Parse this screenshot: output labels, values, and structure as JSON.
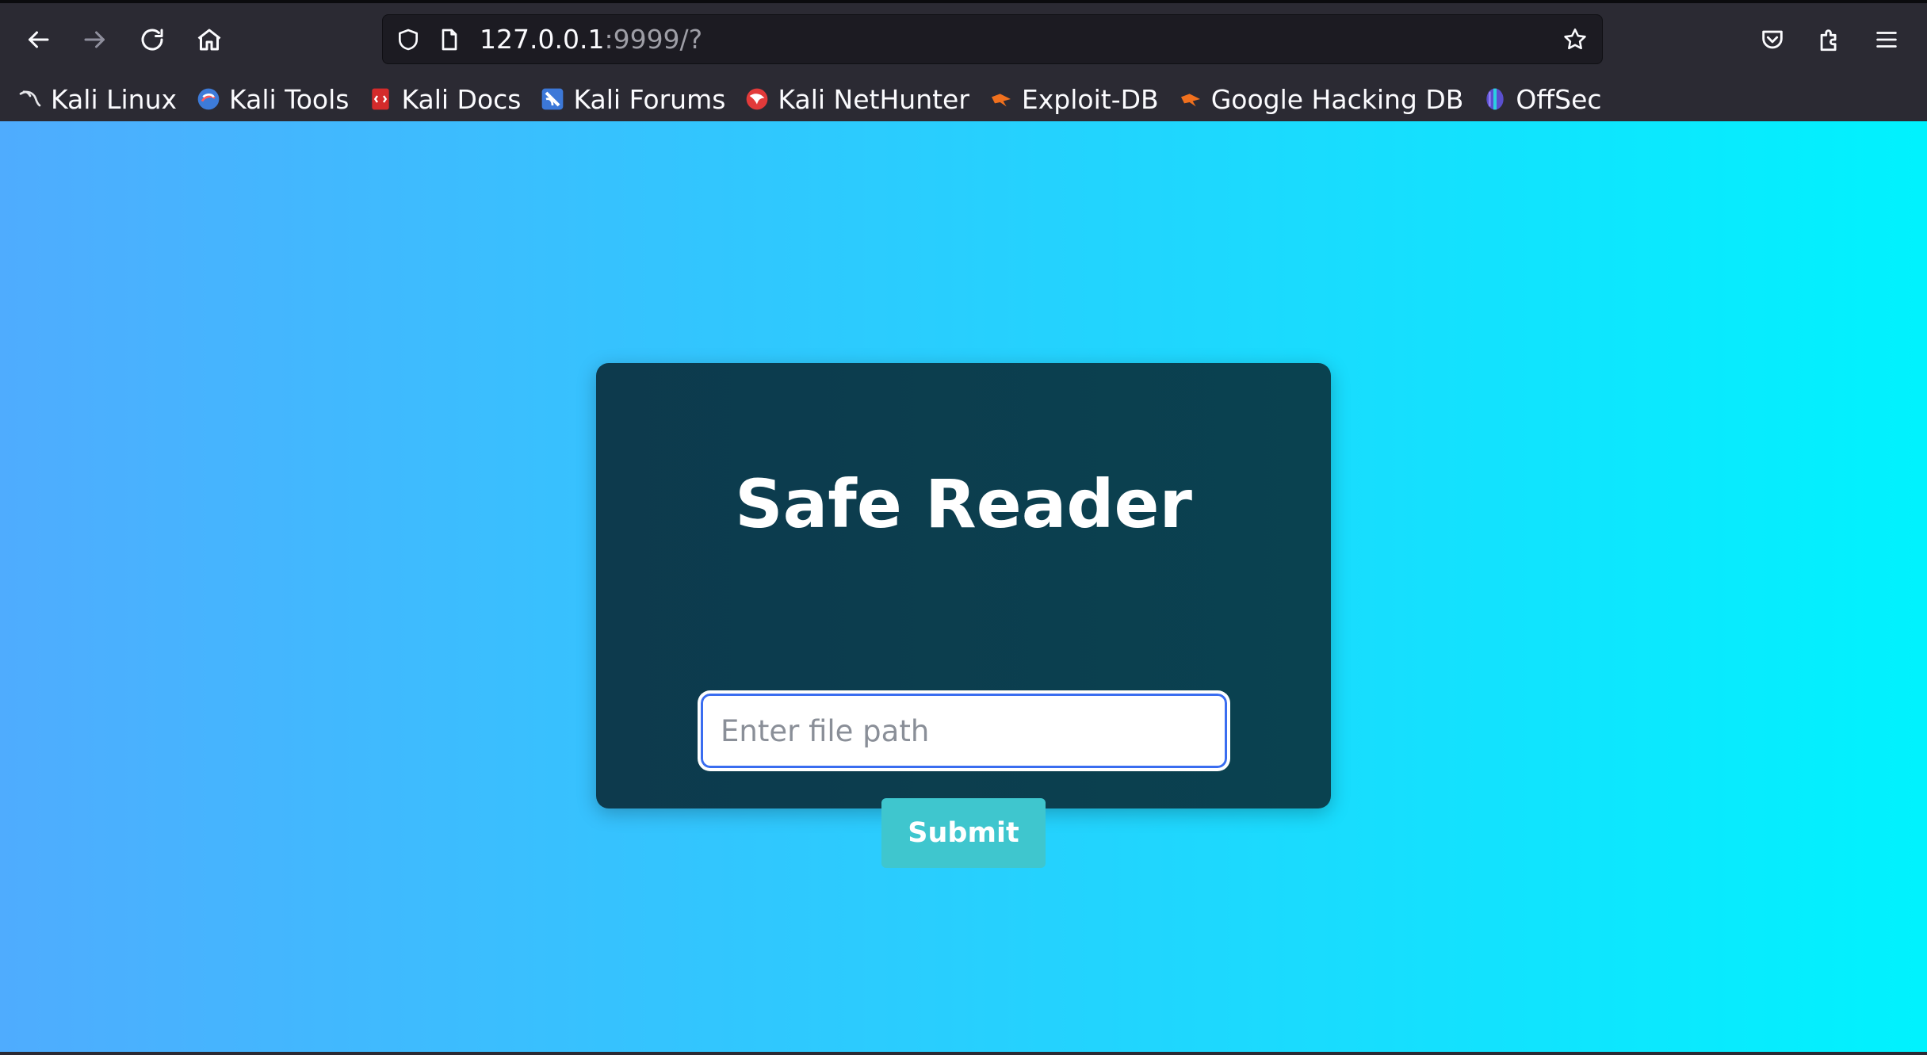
{
  "browser": {
    "url_host": "127.0.0.1",
    "url_rest": ":9999/?",
    "icons": {
      "back": "back-arrow-icon",
      "forward": "forward-arrow-icon",
      "reload": "reload-icon",
      "home": "home-icon",
      "tracking": "shield-icon",
      "page": "page-icon",
      "bookmark_star": "star-icon",
      "pocket": "pocket-icon",
      "extensions": "puzzle-icon",
      "menu": "hamburger-menu-icon"
    }
  },
  "bookmarks": [
    {
      "label": "Kali Linux",
      "icon": "kali-dragon-icon"
    },
    {
      "label": "Kali Tools",
      "icon": "kali-tools-icon"
    },
    {
      "label": "Kali Docs",
      "icon": "kali-docs-icon"
    },
    {
      "label": "Kali Forums",
      "icon": "kali-forums-icon"
    },
    {
      "label": "Kali NetHunter",
      "icon": "nethunter-icon"
    },
    {
      "label": "Exploit-DB",
      "icon": "exploit-db-icon"
    },
    {
      "label": "Google Hacking DB",
      "icon": "ghdb-icon"
    },
    {
      "label": "OffSec",
      "icon": "offsec-icon"
    }
  ],
  "page": {
    "title": "Safe Reader",
    "input_placeholder": "Enter file path",
    "input_value": "",
    "submit_label": "Submit"
  },
  "colors": {
    "gradient_start": "#4facfe",
    "gradient_end": "#00f2fe",
    "card": "#0b3d4d",
    "button": "#3fc6ce"
  }
}
